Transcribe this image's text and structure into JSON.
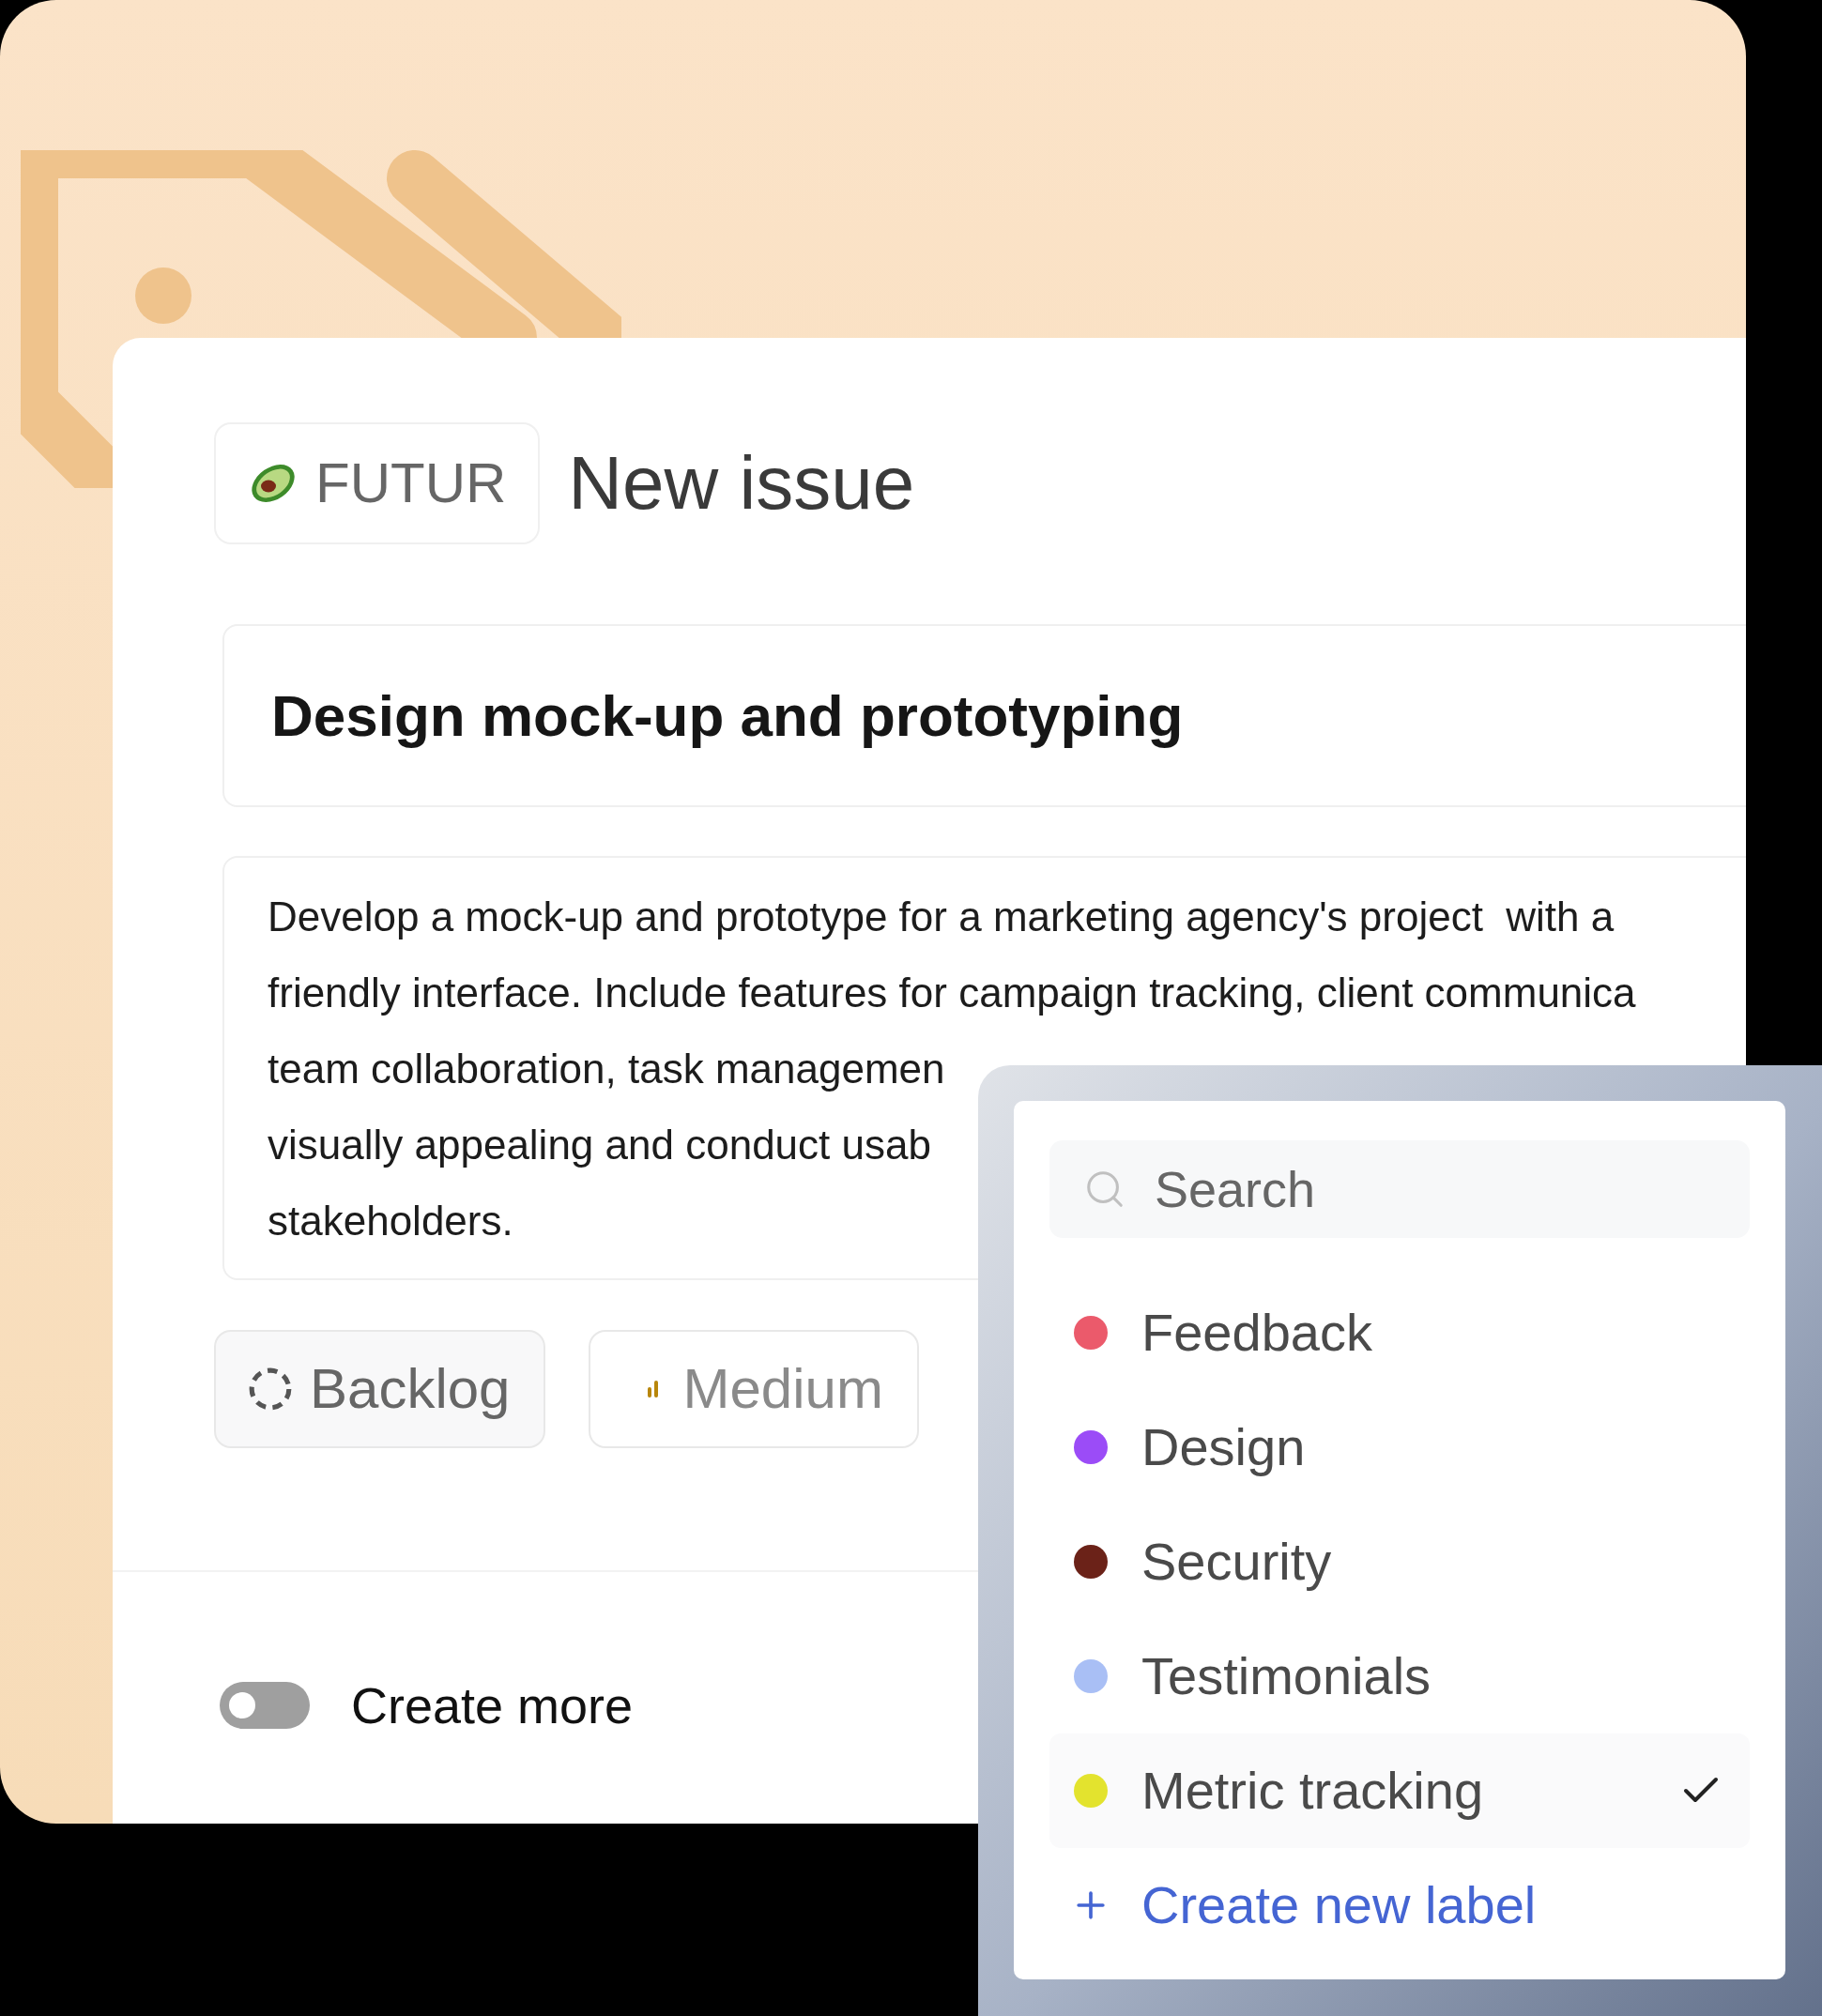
{
  "team_chip": {
    "label": "FUTUR"
  },
  "heading": "New issue",
  "issue_title": "Design mock-up and prototyping",
  "description_lines": [
    "Develop a mock-up and prototype for a marketing agency's project  with a",
    "friendly interface. Include features for campaign tracking, client communica",
    "team collaboration, task managemen",
    "visually appealing and conduct usab",
    "stakeholders."
  ],
  "properties": [
    {
      "kind": "status",
      "label": "Backlog"
    },
    {
      "kind": "priority",
      "label": "Medium"
    }
  ],
  "create_more": {
    "label": "Create more",
    "on": false
  },
  "label_menu": {
    "search": {
      "placeholder": "Search"
    },
    "items": [
      {
        "name": "Feedback",
        "color": "#eb5a6b",
        "selected": false
      },
      {
        "name": "Design",
        "color": "#9b4cf7",
        "selected": false
      },
      {
        "name": "Security",
        "color": "#6b2218",
        "selected": false
      },
      {
        "name": "Testimonials",
        "color": "#a9bff5",
        "selected": false
      },
      {
        "name": "Metric tracking",
        "color": "#e3e32e",
        "selected": true
      }
    ],
    "create_label": "Create new label"
  }
}
